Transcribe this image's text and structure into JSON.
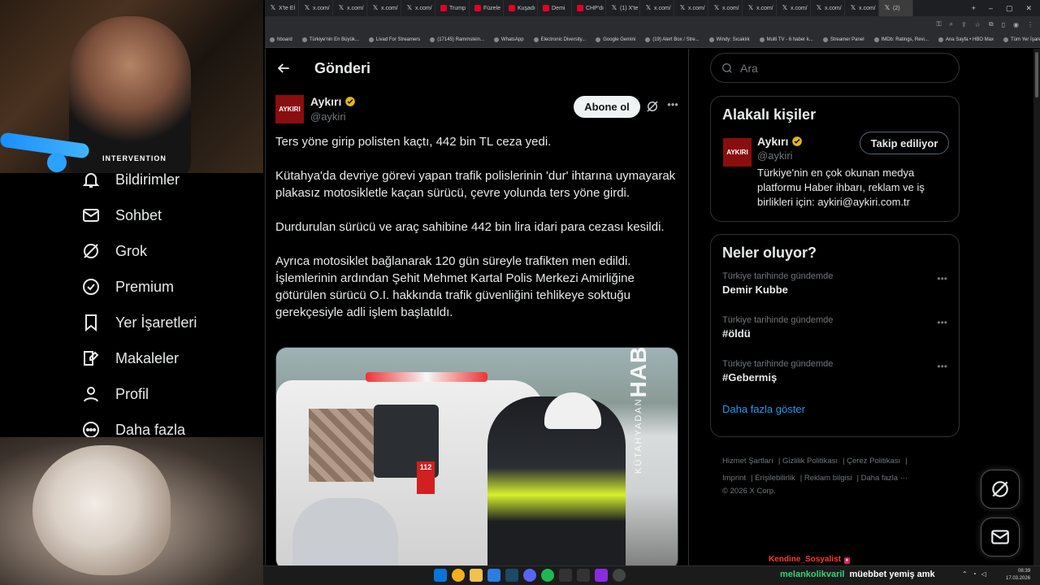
{
  "browser": {
    "tabs": [
      {
        "label": "X'te Eİ",
        "icon": "x-icon"
      },
      {
        "label": "x.com/",
        "icon": "x-icon"
      },
      {
        "label": "x.com/",
        "icon": "x-icon"
      },
      {
        "label": "x.com/",
        "icon": "x-icon"
      },
      {
        "label": "x.com/",
        "icon": "x-icon"
      },
      {
        "label": "Trump",
        "icon": "news-icon"
      },
      {
        "label": "Füzele",
        "icon": "news-icon"
      },
      {
        "label": "Kuşadı",
        "icon": "news-icon"
      },
      {
        "label": "Demi",
        "icon": "news-icon"
      },
      {
        "label": "CHP'dı",
        "icon": "news-icon"
      },
      {
        "label": "(1) X'te",
        "icon": "x-icon"
      },
      {
        "label": "x.com/",
        "icon": "x-icon"
      },
      {
        "label": "x.com/",
        "icon": "x-icon"
      },
      {
        "label": "x.com/",
        "icon": "x-icon"
      },
      {
        "label": "x.com/",
        "icon": "x-icon"
      },
      {
        "label": "x.com/",
        "icon": "x-icon"
      },
      {
        "label": "x.com/",
        "icon": "x-icon"
      },
      {
        "label": "x.com/",
        "icon": "x-icon"
      },
      {
        "label": "(2)",
        "icon": "x-icon"
      }
    ],
    "bookmarks": [
      "hboard",
      "Türkiye'nin En Büyük...",
      "Livad For Streamers",
      "(17145) Rammstein...",
      "WhatsApp",
      "Electronic Diversity...",
      "Google Gemini",
      "(19) Alert Box / Stre...",
      "Windy: Sıcaklık",
      "Multi TV - 6 haber k...",
      "Streamer Panel",
      "IMDb: Ratings, Revi...",
      "Ana Sayfa • HBO Max",
      "Tüm Yer İşaretleri"
    ]
  },
  "webcam": {
    "shirt_text": "INTERVENTION"
  },
  "nav": {
    "items": [
      {
        "label": "Bildirimler",
        "icon": "bell-icon"
      },
      {
        "label": "Sohbet",
        "icon": "mail-icon"
      },
      {
        "label": "Grok",
        "icon": "grok-icon"
      },
      {
        "label": "Premium",
        "icon": "premium-icon"
      },
      {
        "label": "Yer İşaretleri",
        "icon": "bookmark-icon"
      },
      {
        "label": "Makaleler",
        "icon": "article-icon"
      },
      {
        "label": "Profil",
        "icon": "profile-icon"
      },
      {
        "label": "Daha fazla",
        "icon": "more-icon"
      }
    ]
  },
  "post": {
    "header_title": "Gönderi",
    "author_name": "Aykırı",
    "author_handle": "@aykiri",
    "avatar_text": "AYKIRI",
    "subscribe_label": "Abone ol",
    "paragraphs": [
      "Ters yöne girip polisten kaçtı, 442 bin TL ceza yedi.",
      "Kütahya'da devriye görevi yapan trafik polislerinin 'dur' ihtarına uymayarak plakasız motosikletle kaçan sürücü, çevre yolunda ters yöne girdi.",
      "Durdurulan sürücü ve araç sahibine 442 bin lira idari para cezası kesildi.",
      "Ayrıca motosiklet bağlanarak 120 gün süreyle trafikten men edildi. İşlemlerinin ardından Şehit Mehmet Kartal Polis Merkezi Amirliğine götürülen sürücü O.I. hakkında trafik güvenliğini tehlikeye soktuğu gerekçesiyle adli işlem başlatıldı."
    ],
    "media_watermark_small": "KÜTAHYADAN",
    "media_watermark_big": "HABER",
    "media_vehicle_plate": "112"
  },
  "sidebar": {
    "search_placeholder": "Ara",
    "related_title": "Alakalı kişiler",
    "related": {
      "name": "Aykırı",
      "handle": "@aykiri",
      "avatar_text": "AYKIRI",
      "bio": "Türkiye'nin en çok okunan medya platformu Haber ihbarı, reklam ve iş birlikleri için: aykiri@aykiri.com.tr",
      "follow_label": "Takip ediliyor"
    },
    "trends_title": "Neler oluyor?",
    "trends": [
      {
        "context": "Türkiye tarihinde gündemde",
        "topic": "Demir Kubbe"
      },
      {
        "context": "Türkiye tarihinde gündemde",
        "topic": "#öldü"
      },
      {
        "context": "Türkiye tarihinde gündemde",
        "topic": "#Gebermiş"
      }
    ],
    "show_more": "Daha fazla göster",
    "footer": {
      "terms": "Hizmet Şartları",
      "privacy": "Gizlilik Politikası",
      "cookies": "Çerez Politikası",
      "imprint": "Imprint",
      "access": "Erişilebilirlik",
      "ads": "Reklam bilgisi",
      "more": "Daha fazla ···",
      "copyright": "© 2026 X Corp."
    }
  },
  "chat": {
    "line1_user": "Kendine_Sosyalist",
    "line2_user": "melankolikvaril",
    "line2_msg": "müebbet yemiş amk"
  },
  "taskbar": {
    "time": "08:39",
    "date": "17.03.2026"
  },
  "colors": {
    "accent": "#1d9bf0",
    "verified": "#e2b719",
    "brand_red": "#8a0e0e"
  }
}
